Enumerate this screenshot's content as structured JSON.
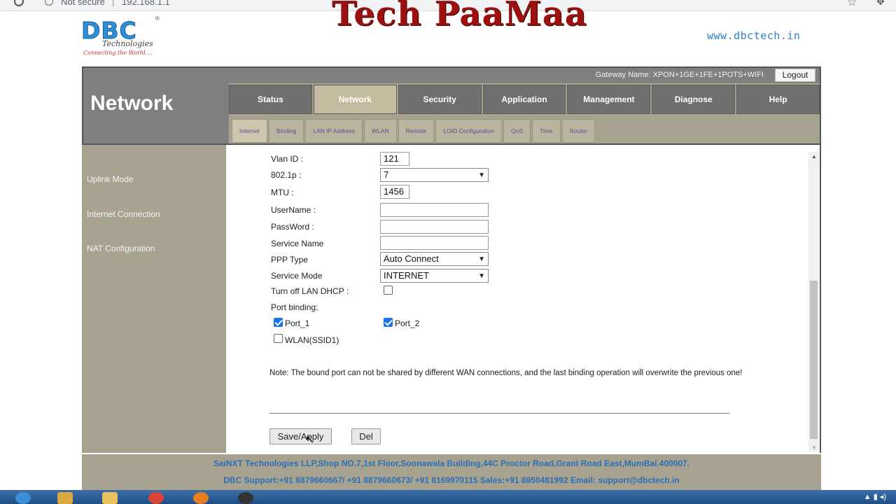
{
  "browser": {
    "security_label": "Not secure",
    "separator": "|",
    "url": "192.168.1.1"
  },
  "watermark": "Tech PaaMaa",
  "brand": {
    "logo_text": "DBC",
    "logo_sub": "Technologies",
    "logo_tagline": "Connecting the World....",
    "logo_reg": "®",
    "website": "www.dbctech.in"
  },
  "header": {
    "section_title": "Network",
    "gateway_name": "Gateway Name: XPON+1GE+1FE+1POTS+WIFI",
    "logout_label": "Logout"
  },
  "main_nav": [
    {
      "label": "Status",
      "active": false
    },
    {
      "label": "Network",
      "active": true
    },
    {
      "label": "Security",
      "active": false
    },
    {
      "label": "Application",
      "active": false
    },
    {
      "label": "Management",
      "active": false
    },
    {
      "label": "Diagnose",
      "active": false
    },
    {
      "label": "Help",
      "active": false
    }
  ],
  "sub_nav": [
    {
      "label": "Internet",
      "active": true
    },
    {
      "label": "Binding",
      "active": false
    },
    {
      "label": "LAN IP Address",
      "active": false
    },
    {
      "label": "WLAN",
      "active": false
    },
    {
      "label": "Remote",
      "active": false
    },
    {
      "label": "LOID Configuration",
      "active": false
    },
    {
      "label": "QoS",
      "active": false
    },
    {
      "label": "Time",
      "active": false
    },
    {
      "label": "Router",
      "active": false
    }
  ],
  "sidebar": {
    "items": [
      "Uplink Mode",
      "Internet Connection",
      "NAT Configuration"
    ]
  },
  "form": {
    "vlan_id_label": "Vlan ID :",
    "vlan_id_value": "121",
    "p8021_label": "802.1p :",
    "p8021_value": "7",
    "mtu_label": "MTU :",
    "mtu_value": "1456",
    "username_label": "UserName :",
    "username_value": "",
    "password_label": "PassWord :",
    "password_value": "",
    "service_name_label": "Service Name",
    "service_name_value": "",
    "ppp_type_label": "PPP Type",
    "ppp_type_value": "Auto Connect",
    "service_mode_label": "Service Mode",
    "service_mode_value": "INTERNET",
    "lan_dhcp_label": "Turn off LAN DHCP :",
    "lan_dhcp_checked": false,
    "port_binding_label": "Port binding:",
    "ports": [
      {
        "label": "Port_1",
        "checked": true
      },
      {
        "label": "Port_2",
        "checked": true
      },
      {
        "label": "WLAN(SSID1)",
        "checked": false
      }
    ],
    "note": "Note: The bound port can not be shared by different WAN connections, and the last binding operation will overwrite the previous one!",
    "save_label": "Save/Apply",
    "del_label": "Del"
  },
  "footer": {
    "address": "SaiNXT Technologies LLP,Shop NO.7,1st Floor,Soonawala Building,44C Proctor Road,Grant Road East,MumBai.400007.",
    "support": "DBC Support:+91 8879660667/ +91 8879660673/ +91 8169970115 Sales:+91 8850481992 Email: support@dbctech.in"
  },
  "colors": {
    "frame": "#a8a391",
    "nav_tab": "#6f6f6f",
    "nav_active": "#c4bca0",
    "footer_text": "#2b6fb5",
    "watermark": "#9c1010",
    "logo": "#2d8fd5"
  }
}
